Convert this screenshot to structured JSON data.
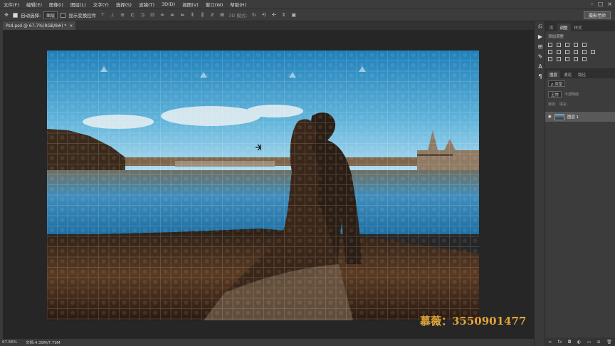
{
  "menubar": {
    "items": [
      "文件(F)",
      "编辑(E)",
      "图像(I)",
      "图层(L)",
      "文字(Y)",
      "选择(S)",
      "滤镜(T)",
      "3D(D)",
      "视图(V)",
      "窗口(W)",
      "帮助(H)"
    ],
    "window_controls": [
      "–",
      "□",
      "×"
    ]
  },
  "options": {
    "auto_select_label": "自动选择:",
    "auto_select_value": "图层",
    "show_transform_label": "显示变换控件",
    "mode_3d_label": "3D 模式:"
  },
  "workspace": {
    "label": "摄影老师"
  },
  "document": {
    "tab_title": "Psd.psd @ 67.7%(RGB/8#) *",
    "close": "×"
  },
  "status": {
    "zoom": "67.66%",
    "doc_size": "文档:4.39M/7.79M"
  },
  "watermark": {
    "text": "慕薇：3550901477"
  },
  "right_panel": {
    "top_tabs": [
      "库",
      "调整",
      "样式"
    ],
    "active_top_tab": "调整",
    "adjustments_title": "添加调整",
    "layer_tabs": [
      "图层",
      "通道",
      "路径"
    ],
    "kind_label": "ρ 类型",
    "blend_mode": "正常",
    "opacity_label": "不透明度:",
    "lock_label": "锁定:",
    "fill_label": "填充:",
    "layer_name": "图层 1"
  },
  "colors": {
    "app_bg": "#282828",
    "chrome": "#3c3c3c",
    "watermark": "#e0a53a",
    "sky_top": "#1e7fb8",
    "sky_bottom": "#bfe3f2"
  }
}
